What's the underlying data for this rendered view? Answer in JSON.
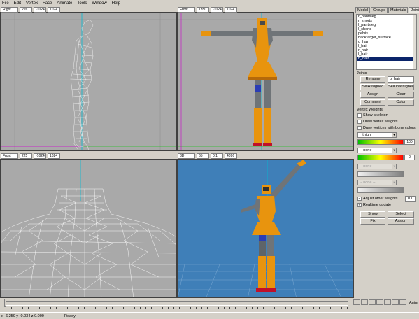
{
  "menu": [
    "File",
    "Edit",
    "Vertex",
    "Face",
    "Animate",
    "Tools",
    "Window",
    "Help"
  ],
  "viewports": {
    "top_left": {
      "view": "Right",
      "fields": [
        "226",
        "-1024",
        "1024"
      ]
    },
    "top_right": {
      "view": "Front",
      "fields": [
        "1350",
        "-1024",
        "1024"
      ]
    },
    "bottom_left": {
      "view": "Front",
      "fields": [
        "225",
        "-1024",
        "1024"
      ]
    },
    "bottom_right": {
      "view": "3D",
      "fields": [
        "65",
        "0.1",
        "4096"
      ]
    }
  },
  "tabs": [
    "Model",
    "Groups",
    "Materials",
    "Joints"
  ],
  "joint_list": {
    "items": [
      "r_pantsleg",
      "r_shorts",
      "l_pantsleg",
      "l_shorts",
      "pelvis",
      "backtarget_surface",
      "c_hair",
      "l_hair",
      "r_hair",
      "l_hair",
      "b_hair"
    ],
    "selected": "b_hair"
  },
  "joints_section": {
    "title": "Joints",
    "rename_label": "Rename",
    "name_value": "b_hair",
    "sel_assigned": "SelAssigned",
    "sel_unassigned": "SelUnassigned",
    "assign": "Assign",
    "clear": "Clear",
    "comment": "Comment",
    "color": "Color"
  },
  "vertex_weights": {
    "title": "Vertex Weights",
    "show_skeleton": "Show skeleton",
    "draw_vertex_weights": "Draw vertex weights",
    "draw_vertices_bone_colors": "Draw vertices with bone colors",
    "joint1": "l_thigh",
    "weight1": "100",
    "joint2": "-- none --",
    "weight2": "0",
    "joint3": "-- none --",
    "joint4": "-- none --",
    "adjust_other_weights": "Adjust other weights",
    "adjust_value": "100",
    "realtime_update": "Realtime update",
    "show": "Show",
    "select": "Select",
    "fix": "Fix",
    "assign": "Assign"
  },
  "anim_label": "Anim",
  "status": {
    "coords": "x -6.259 y -0.034 z 0.000",
    "state": "Ready."
  },
  "colors": {
    "viewport_bg": "#a9a9a9",
    "view3d_bg": "#3f7fb8",
    "wire": "#ffffff",
    "body_orange": "#e8940e",
    "body_grey": "#6f7478",
    "selection": "#0a246a"
  }
}
